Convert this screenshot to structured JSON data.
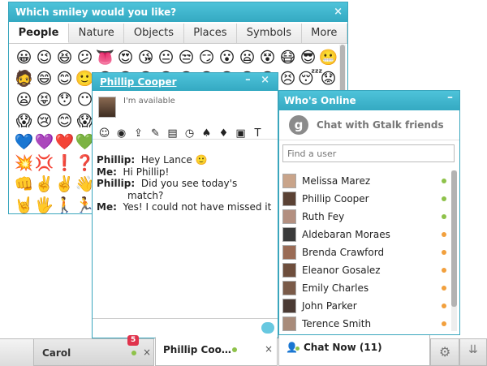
{
  "picker": {
    "title": "Which smiley would you like?",
    "close": "×",
    "tabs": [
      "People",
      "Nature",
      "Objects",
      "Places",
      "Symbols",
      "More"
    ],
    "active_tab": "People",
    "emoji_rows": [
      [
        "😀",
        "😉",
        "😆",
        "😕",
        "👅",
        "😍",
        "😘",
        "😐",
        "😒",
        "😏",
        "😮",
        "😦",
        "😵",
        "😷",
        "😎",
        "😬"
      ],
      [
        "🧔",
        "😄",
        "😊",
        "🙂",
        "😋",
        "😛",
        "😜",
        "😁",
        "😂",
        "😅",
        "😆",
        "😃",
        "😑",
        "😣",
        "😴",
        "😟"
      ],
      [
        "😦",
        "😝",
        "😯",
        "😶",
        "😟",
        "😨",
        "😧",
        "😡",
        "😳",
        "😠",
        "😤",
        "😰",
        "😩",
        "😫",
        "😲",
        "😭"
      ],
      [
        "😱",
        "😢",
        "😊",
        "😱",
        "😰",
        "😨",
        "😭",
        "😵",
        "😠",
        "😡",
        "😷",
        "😖",
        "😓",
        "😔",
        "😪",
        "😥"
      ],
      [
        "💙",
        "💜",
        "❤️",
        "💚",
        "💛",
        "💗",
        "💔",
        "💖",
        "💘",
        "💝",
        "💞",
        "💟",
        "❣️",
        "💋",
        "💌",
        "💕"
      ],
      [
        "💥",
        "💢",
        "❗",
        "❓",
        "💤",
        "💨",
        "💦",
        "🎵",
        "🔥",
        "💩",
        "👍",
        "👎",
        "👌",
        "👊",
        "✊",
        "✌️"
      ],
      [
        "👊",
        "✌️",
        "✌️",
        "👋",
        "✋",
        "👐",
        "👆",
        "👇",
        "👉",
        "👈",
        "🙌",
        "🙏",
        "☝️",
        "👏",
        "💪",
        "🚶"
      ],
      [
        "🤘",
        "🖐️",
        "🚶",
        "🏃",
        "👫",
        "👪",
        "👬",
        "👭",
        "💏",
        "💑",
        "👯",
        "🙆",
        "🙅",
        "💁",
        "🙋",
        "💇"
      ]
    ]
  },
  "chat": {
    "contact_name": "Phillip Cooper",
    "controls": "– ×",
    "status": "I'm available",
    "toolbar": [
      {
        "name": "smiley-icon",
        "glyph": "☺"
      },
      {
        "name": "nudge-icon",
        "glyph": "◉"
      },
      {
        "name": "upload-icon",
        "glyph": "⇪"
      },
      {
        "name": "pencil-icon",
        "glyph": "✎"
      },
      {
        "name": "text-icon",
        "glyph": "▤"
      },
      {
        "name": "clock-icon",
        "glyph": "◷"
      },
      {
        "name": "broom-icon",
        "glyph": "♠"
      },
      {
        "name": "cards-icon",
        "glyph": "♦"
      },
      {
        "name": "save-icon",
        "glyph": "▣"
      },
      {
        "name": "font-icon",
        "glyph": "T"
      }
    ],
    "messages": [
      {
        "who": "Phillip:",
        "text": "Hey Lance 🙂"
      },
      {
        "who": "Me:",
        "text": "Hi Phillip!"
      },
      {
        "who": "Phillip:",
        "text": "Did you see today's"
      },
      {
        "who": "",
        "text": "match?"
      },
      {
        "who": "Me:",
        "text": "Yes! I could not have missed it"
      }
    ]
  },
  "online": {
    "title": "Who's Online",
    "minimize": "–",
    "gtalk_label": "Chat with Gtalk friends",
    "gtalk_glyph": "g",
    "search_placeholder": "Find a user",
    "users": [
      {
        "name": "Melissa Marez",
        "status_color": "#8ec24a",
        "avatar": "#c9a48a"
      },
      {
        "name": "Phillip Cooper",
        "status_color": "#8ec24a",
        "avatar": "#5b4234"
      },
      {
        "name": "Ruth Fey",
        "status_color": "#8ec24a",
        "avatar": "#b38f80"
      },
      {
        "name": "Aldebaran Moraes",
        "status_color": "#f2a03d",
        "avatar": "#3a3a3a"
      },
      {
        "name": "Brenda Crawford",
        "status_color": "#f2a03d",
        "avatar": "#9a6b55"
      },
      {
        "name": "Eleanor Gosalez",
        "status_color": "#f2a03d",
        "avatar": "#6e4e3c"
      },
      {
        "name": "Emily Charles",
        "status_color": "#f2a03d",
        "avatar": "#7a5a48"
      },
      {
        "name": "John Parker",
        "status_color": "#f2a03d",
        "avatar": "#4b3a33"
      },
      {
        "name": "Terence Smith",
        "status_color": "#f2a03d",
        "avatar": "#a88b7a"
      }
    ]
  },
  "bar": {
    "carol_label": "Carol",
    "carol_badge": "5",
    "phillip_label": "Phillip Coo…",
    "close": "×",
    "chat_now": "Chat Now (11)",
    "chat_now_icon": "👤",
    "gear_glyph": "⚙",
    "down_glyph": "⇊"
  }
}
